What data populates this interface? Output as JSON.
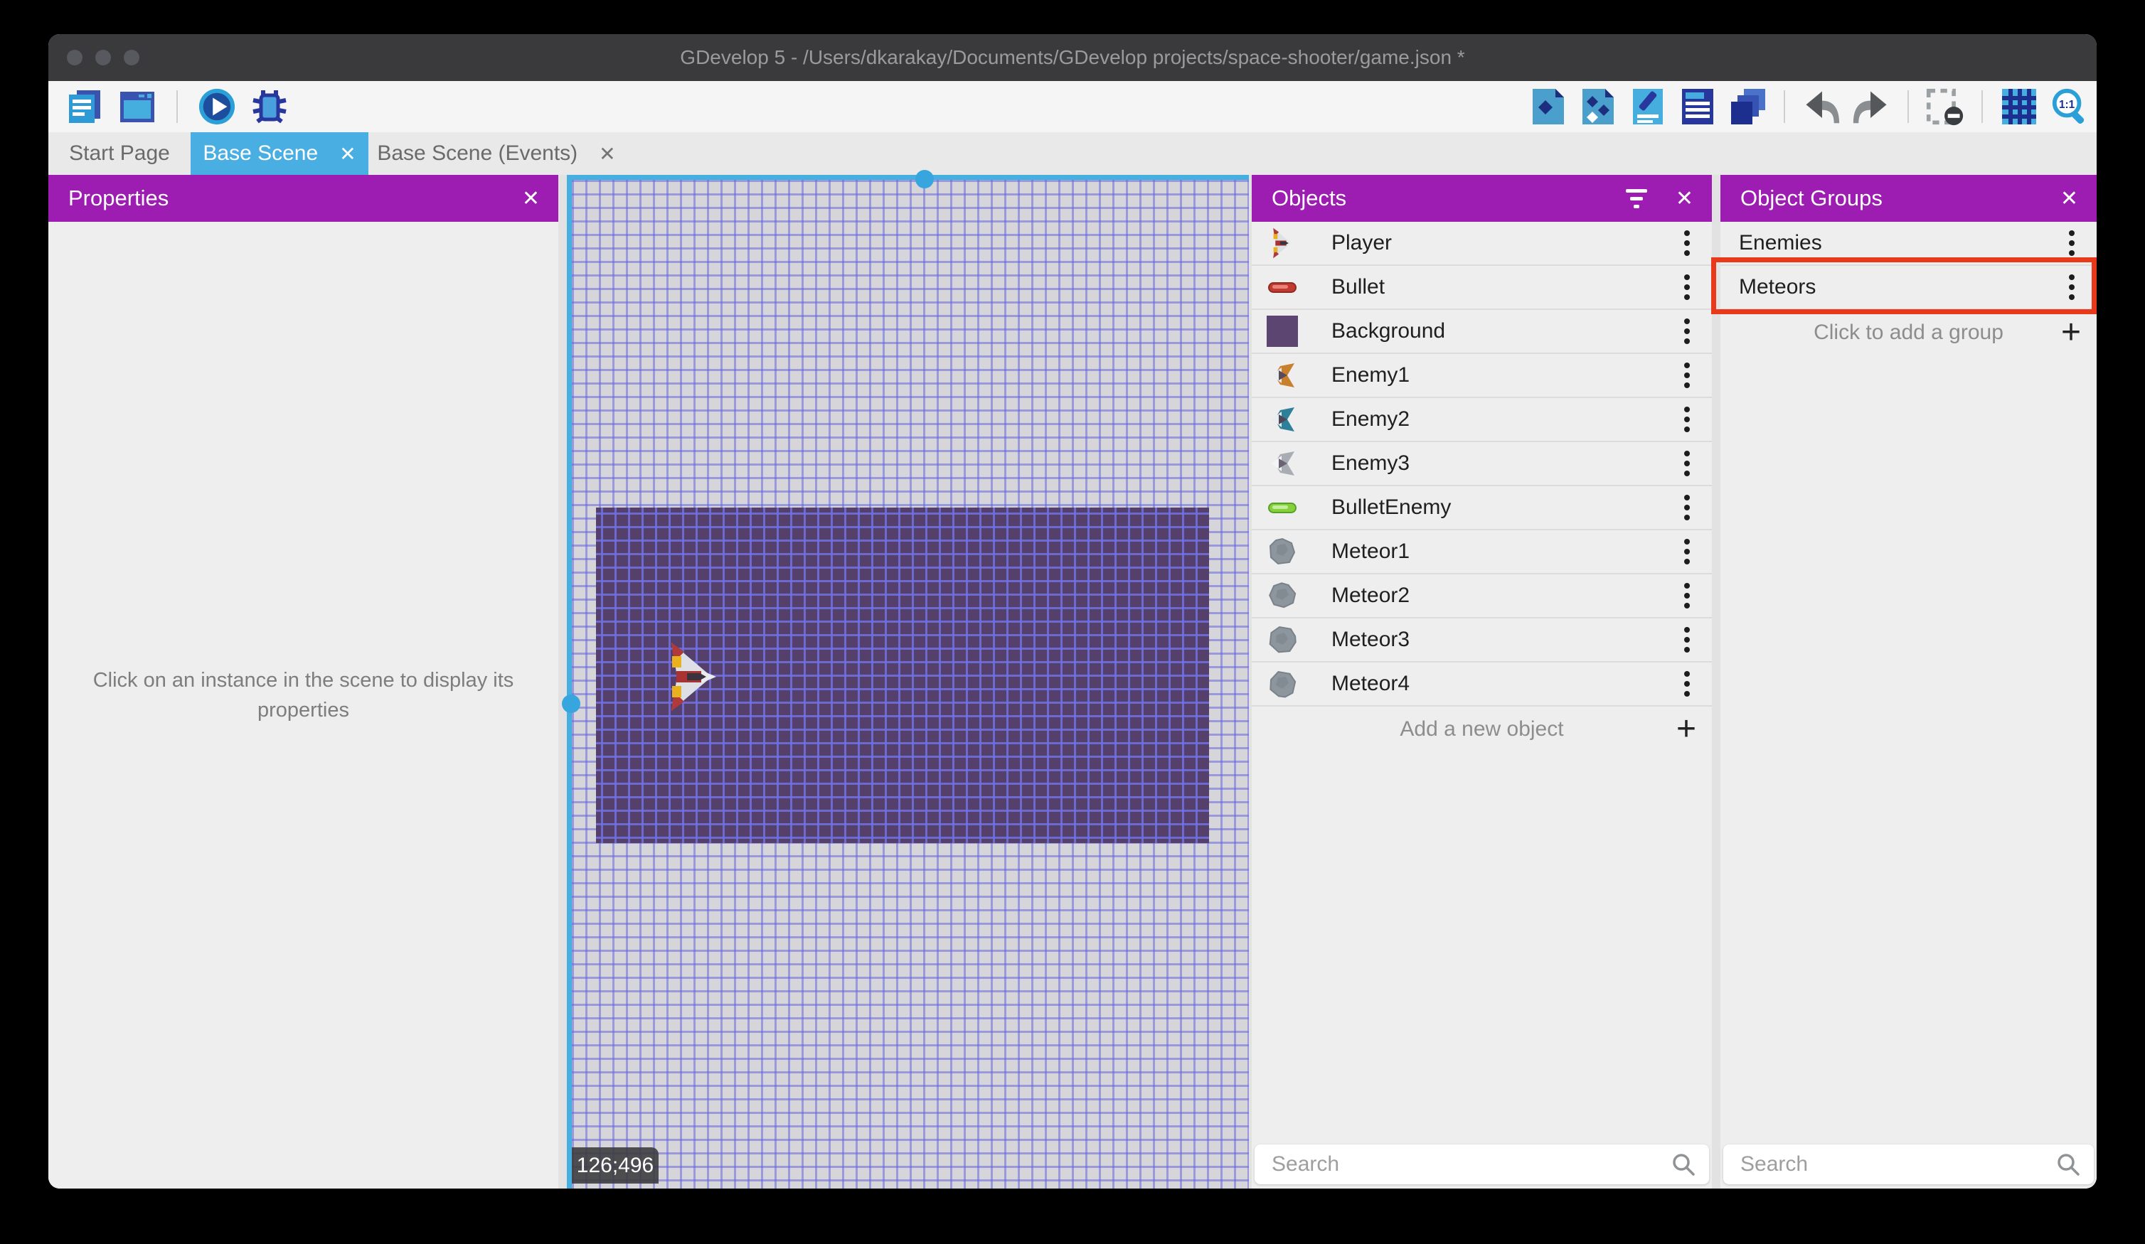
{
  "colors": {
    "accent_purple": "#9d1db2",
    "active_tab_blue": "#49aee2",
    "highlight_red": "#e8391a",
    "grid_line": "#6868de",
    "scene_rect_bg": "#55406b",
    "scroll_blue": "#38a6de"
  },
  "window": {
    "title": "GDevelop 5 - /Users/dkarakay/Documents/GDevelop projects/space-shooter/game.json *"
  },
  "toolbar": {
    "left_icons": [
      "project-manager",
      "start-page",
      "play",
      "debug"
    ],
    "right_icons": [
      "export",
      "objects-editor",
      "scene-properties-edit",
      "instances-list",
      "layers",
      "undo",
      "redo",
      "mask",
      "grid",
      "zoom-1-1"
    ]
  },
  "tabs": [
    {
      "label": "Start Page"
    },
    {
      "label": "Base Scene",
      "close": "✕",
      "active": true
    },
    {
      "label": "Base Scene (Events)",
      "close": "✕"
    }
  ],
  "properties_panel": {
    "title": "Properties",
    "close": "✕",
    "hint": "Click on an instance in the scene to display its properties"
  },
  "scene": {
    "coordinates": "126;496"
  },
  "objects_panel": {
    "title": "Objects",
    "close": "✕",
    "items": [
      {
        "label": "Player"
      },
      {
        "label": "Bullet"
      },
      {
        "label": "Background"
      },
      {
        "label": "Enemy1"
      },
      {
        "label": "Enemy2"
      },
      {
        "label": "Enemy3"
      },
      {
        "label": "BulletEnemy"
      },
      {
        "label": "Meteor1"
      },
      {
        "label": "Meteor2"
      },
      {
        "label": "Meteor3"
      },
      {
        "label": "Meteor4"
      }
    ],
    "add_label": "Add a new object",
    "add_icon": "+",
    "search_placeholder": "Search"
  },
  "object_groups_panel": {
    "title": "Object Groups",
    "close": "✕",
    "groups": [
      {
        "label": "Enemies"
      },
      {
        "label": "Meteors",
        "highlighted": true
      }
    ],
    "add_label": "Click to add a group",
    "add_icon": "+",
    "search_placeholder": "Search"
  }
}
